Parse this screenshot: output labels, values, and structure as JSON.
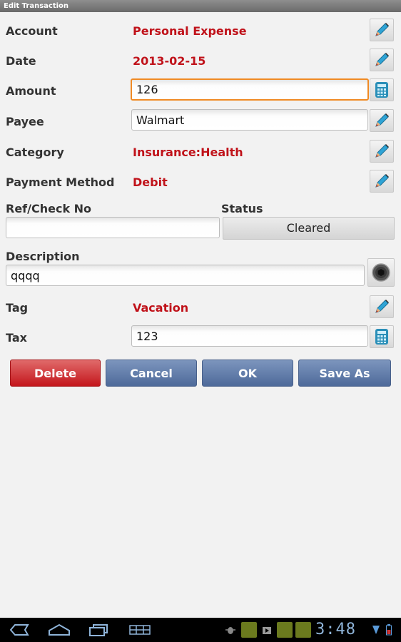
{
  "window": {
    "title": "Edit Transaction"
  },
  "form": {
    "account": {
      "label": "Account",
      "value": "Personal Expense"
    },
    "date": {
      "label": "Date",
      "value": "2013-02-15"
    },
    "amount": {
      "label": "Amount",
      "value": "126"
    },
    "payee": {
      "label": "Payee",
      "value": "Walmart"
    },
    "category": {
      "label": "Category",
      "value": "Insurance:Health"
    },
    "payment_method": {
      "label": "Payment Method",
      "value": "Debit"
    },
    "ref_check": {
      "label": "Ref/Check No",
      "value": ""
    },
    "status": {
      "label": "Status",
      "value": "Cleared"
    },
    "description": {
      "label": "Description",
      "value": "qqqq"
    },
    "tag": {
      "label": "Tag",
      "value": "Vacation"
    },
    "tax": {
      "label": "Tax",
      "value": "123"
    }
  },
  "actions": {
    "delete": "Delete",
    "cancel": "Cancel",
    "ok": "OK",
    "save_as": "Save As"
  },
  "system_bar": {
    "clock": "3:48"
  },
  "colors": {
    "value_red": "#c0121a",
    "focus_orange": "#f08a24",
    "button_blue": "#5a76a6",
    "button_red": "#c4161c"
  }
}
